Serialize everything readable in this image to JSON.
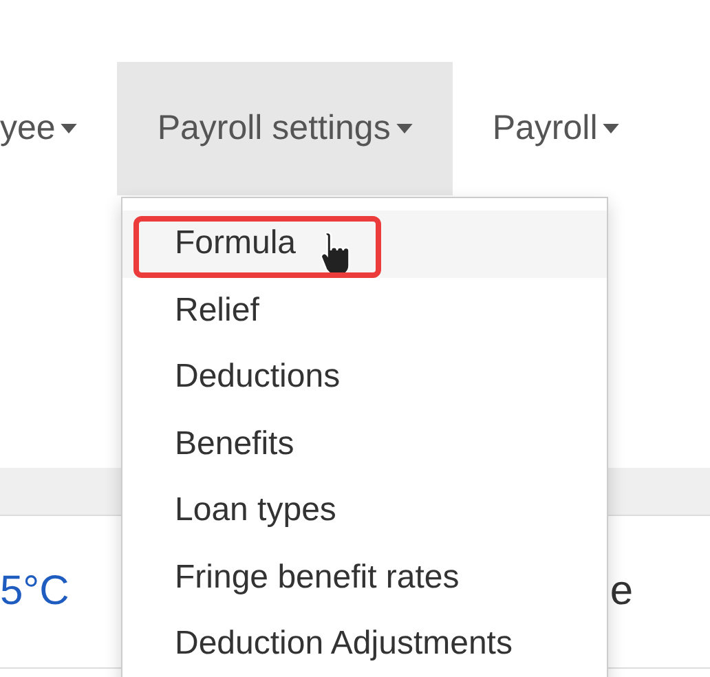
{
  "nav": [
    {
      "label": "yee",
      "selected": false
    },
    {
      "label": "Payroll settings",
      "selected": true
    },
    {
      "label": "Payroll",
      "selected": false
    }
  ],
  "dropdown": {
    "items": [
      {
        "label": "Formula",
        "selected": true,
        "annotated": true
      },
      {
        "label": "Relief",
        "selected": false,
        "annotated": false
      },
      {
        "label": "Deductions",
        "selected": false,
        "annotated": false
      },
      {
        "label": "Benefits",
        "selected": false,
        "annotated": false
      },
      {
        "label": "Loan types",
        "selected": false,
        "annotated": false
      },
      {
        "label": "Fringe benefit rates",
        "selected": false,
        "annotated": false
      },
      {
        "label": "Deduction Adjustments",
        "selected": false,
        "annotated": false
      }
    ]
  },
  "content": {
    "temperature": "5°C",
    "column_2": "e"
  }
}
